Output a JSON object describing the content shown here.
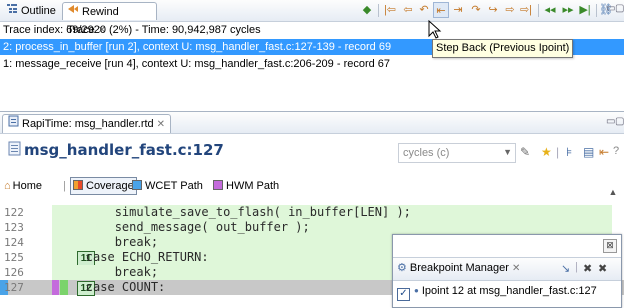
{
  "top_view": {
    "tabs": [
      {
        "label": "Outline",
        "icon": "outline-icon"
      },
      {
        "label": "Rewind Trace",
        "icon": "rewind-trace-icon"
      }
    ],
    "trace_info": "Trace index: 69/2920 (2%) - Time: 90,942,987 cycles",
    "rows": [
      "2: process_in_buffer [run 2], context U: msg_handler_fast.c:127-139 - record 69",
      "1: message_receive [run 4], context U: msg_handler_fast.c:206-209 - record 67"
    ],
    "tooltip": "Step Back (Previous Ipoint)"
  },
  "editor": {
    "tab_label": "RapiTime: msg_handler.rtd",
    "file_title": "msg_handler_fast.c:127",
    "metric_placeholder": "cycles (c)",
    "toolbar": {
      "home": "Home",
      "coverage": "Coverage",
      "wcet_path": "WCET Path",
      "hwm_path": "HWM Path"
    },
    "colors": {
      "coverage": "#f0a030",
      "wcet_path": "#4aa3e8",
      "hwm_path": "#c46bdc",
      "covered_line": "#dff7d9",
      "current_line": "#c8c8c8"
    },
    "code_lines": [
      {
        "num": "122",
        "text": "            simulate_save_to_flash( in_buffer[LEN] );",
        "count": ""
      },
      {
        "num": "123",
        "text": "            send_message( out_buffer );",
        "count": ""
      },
      {
        "num": "124",
        "text": "            break;",
        "count": ""
      },
      {
        "num": "125",
        "text": "        case ECHO_RETURN:",
        "count": "11"
      },
      {
        "num": "126",
        "text": "            break;",
        "count": ""
      },
      {
        "num": "127",
        "text": "        case COUNT:",
        "count": "12"
      }
    ]
  },
  "breakpoint_manager": {
    "title": "Breakpoint Manager",
    "entry": "Ipoint 12 at msg_handler_fast.c:127"
  }
}
